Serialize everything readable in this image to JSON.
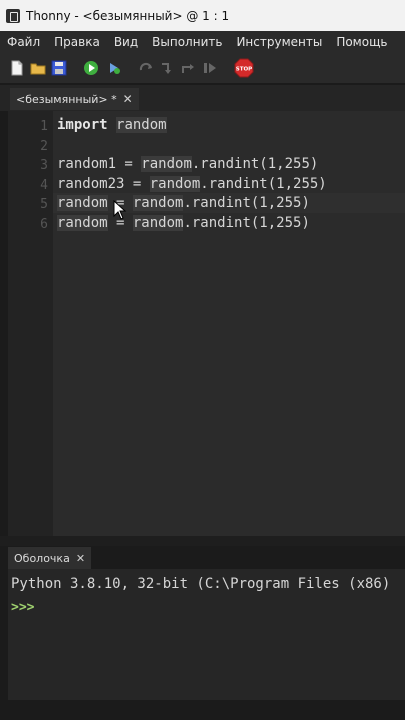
{
  "window": {
    "title": "Thonny - <безымянный> @ 1 : 1"
  },
  "menu": [
    "Файл",
    "Правка",
    "Вид",
    "Выполнить",
    "Инструменты",
    "Помощь"
  ],
  "toolbar": {
    "stop_label": "STOP"
  },
  "editor": {
    "tab_label": "<безымянный> *",
    "tab_close": "✕",
    "line_numbers": [
      "1",
      "2",
      "3",
      "4",
      "5",
      "6"
    ],
    "lines": {
      "l1_kw": "import",
      "l1_mod": "random",
      "l3_a": "random1 = ",
      "l3_b": "random",
      "l3_c": ".randint(1,255)",
      "l4_a": "random23 = ",
      "l4_b": "random",
      "l4_c": ".randint(1,255)",
      "l5_a": "random",
      "l5_b": " = ",
      "l5_c": "random",
      "l5_d": ".randint(1,255)",
      "l6_a": "random",
      "l6_b": " = ",
      "l6_c": "random",
      "l6_d": ".randint(1,255)"
    }
  },
  "shell": {
    "tab_label": "Оболочка",
    "tab_close": "✕",
    "output": "Python 3.8.10, 32-bit (C:\\Program Files (x86)",
    "prompt": ">>>"
  },
  "colors": {
    "run": "#3fae3f",
    "stop": "#d42a2a",
    "prompt": "#9fd16f"
  }
}
